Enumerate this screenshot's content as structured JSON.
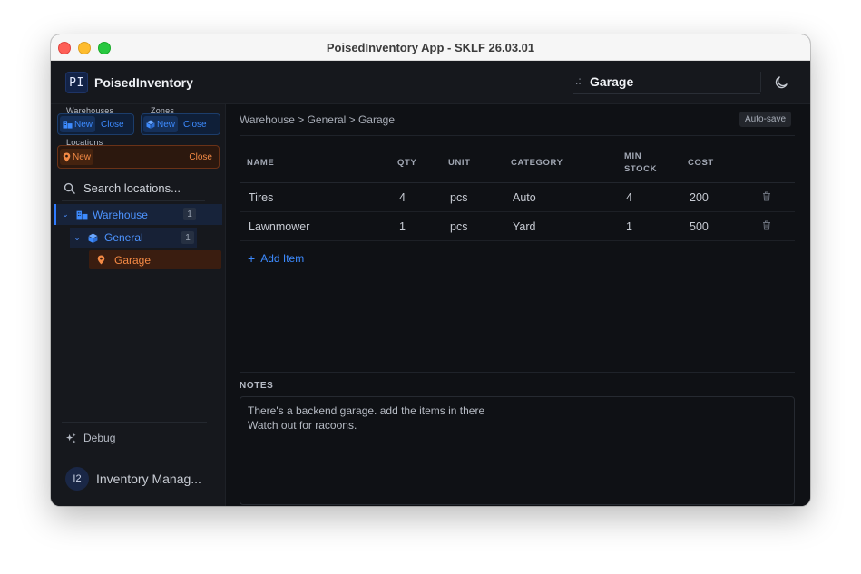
{
  "window": {
    "title": "PoisedInventory App - SKLF 26.03.01"
  },
  "header": {
    "logo": "PI",
    "app_name": "PoisedInventory",
    "location_prefix": ".:",
    "location_value": "Garage"
  },
  "sidebar": {
    "warehouses": {
      "label": "Warehouses",
      "new": "New",
      "close": "Close"
    },
    "zones": {
      "label": "Zones",
      "new": "New",
      "close": "Close"
    },
    "locations": {
      "label": "Locations",
      "new": "New",
      "close": "Close"
    },
    "search_placeholder": "Search locations...",
    "tree": [
      {
        "label": "Warehouse",
        "count": "1",
        "level": 0,
        "icon": "building-icon"
      },
      {
        "label": "General",
        "count": "1",
        "level": 1,
        "icon": "cube-icon"
      },
      {
        "label": "Garage",
        "level": 2,
        "icon": "map-pin-icon"
      }
    ],
    "debug": "Debug",
    "user": {
      "initials": "I2",
      "name": "Inventory Manag..."
    }
  },
  "main": {
    "breadcrumb": "Warehouse > General > Garage",
    "autosave": "Auto-save",
    "columns": {
      "name": "NAME",
      "qty": "QTY",
      "unit": "UNIT",
      "category": "CATEGORY",
      "min_stock_1": "MIN",
      "min_stock_2": "STOCK",
      "cost": "COST"
    },
    "rows": [
      {
        "name": "Tires",
        "qty": "4",
        "unit": "pcs",
        "category": "Auto",
        "min_stock": "4",
        "cost": "200"
      },
      {
        "name": "Lawnmower",
        "qty": "1",
        "unit": "pcs",
        "category": "Yard",
        "min_stock": "1",
        "cost": "500"
      }
    ],
    "add_item": "Add Item",
    "notes_label": "NOTES",
    "notes": [
      "There's a backend garage. add the items in there",
      "Watch out for racoons."
    ]
  },
  "colors": {
    "accent_blue": "#3d8bff",
    "accent_orange": "#f48a45",
    "background": "#0f1115",
    "sidebar": "#16181d"
  }
}
